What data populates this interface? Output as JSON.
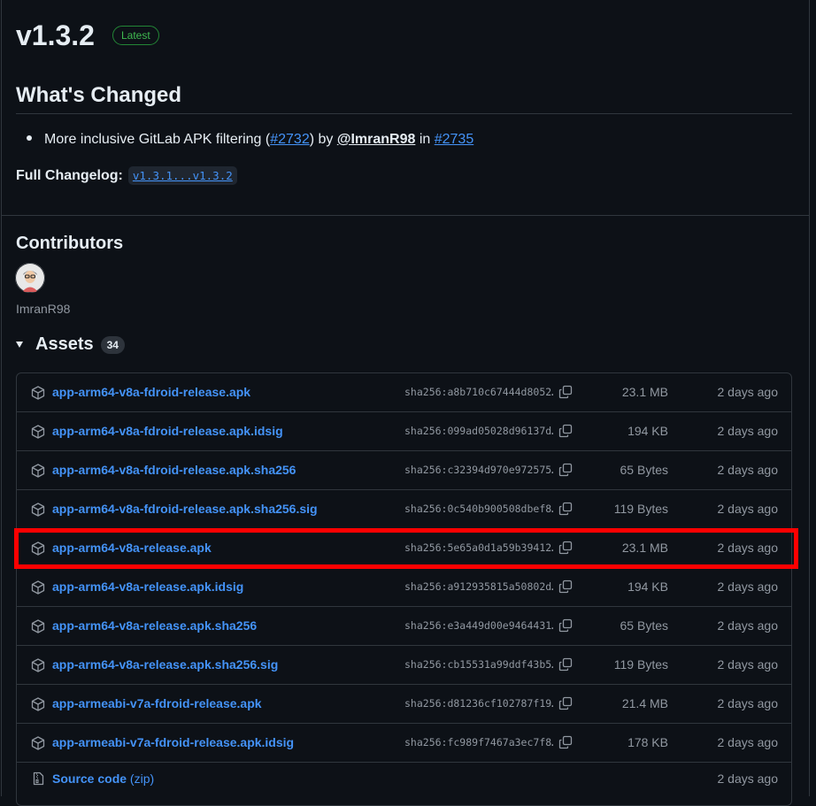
{
  "release": {
    "title": "v1.3.2",
    "latest_badge": "Latest"
  },
  "whats_changed": {
    "heading": "What's Changed",
    "item": {
      "text_start": "More inclusive GitLab APK filtering (",
      "pr_link": "#2732",
      "text_mid": ") by ",
      "author": "@ImranR98",
      "text_in": " in ",
      "in_link": "#2735"
    },
    "full_changelog_label": "Full Changelog:",
    "full_changelog_link": "v1.3.1...v1.3.2"
  },
  "contributors": {
    "heading": "Contributors",
    "names": [
      "ImranR98"
    ]
  },
  "assets": {
    "heading": "Assets",
    "count": "34",
    "rows": [
      {
        "name": "app-arm64-v8a-fdroid-release.apk",
        "sha": "sha256:a8b710c67444d8052…",
        "size": "23.1 MB",
        "date": "2 days ago"
      },
      {
        "name": "app-arm64-v8a-fdroid-release.apk.idsig",
        "sha": "sha256:099ad05028d96137d…",
        "size": "194 KB",
        "date": "2 days ago"
      },
      {
        "name": "app-arm64-v8a-fdroid-release.apk.sha256",
        "sha": "sha256:c32394d970e972575…",
        "size": "65 Bytes",
        "date": "2 days ago"
      },
      {
        "name": "app-arm64-v8a-fdroid-release.apk.sha256.sig",
        "sha": "sha256:0c540b900508dbef8…",
        "size": "119 Bytes",
        "date": "2 days ago"
      },
      {
        "name": "app-arm64-v8a-release.apk",
        "sha": "sha256:5e65a0d1a59b39412…",
        "size": "23.1 MB",
        "date": "2 days ago"
      },
      {
        "name": "app-arm64-v8a-release.apk.idsig",
        "sha": "sha256:a912935815a50802d…",
        "size": "194 KB",
        "date": "2 days ago"
      },
      {
        "name": "app-arm64-v8a-release.apk.sha256",
        "sha": "sha256:e3a449d00e9464431…",
        "size": "65 Bytes",
        "date": "2 days ago"
      },
      {
        "name": "app-arm64-v8a-release.apk.sha256.sig",
        "sha": "sha256:cb15531a99ddf43b5…",
        "size": "119 Bytes",
        "date": "2 days ago"
      },
      {
        "name": "app-armeabi-v7a-fdroid-release.apk",
        "sha": "sha256:d81236cf102787f19…",
        "size": "21.4 MB",
        "date": "2 days ago"
      },
      {
        "name": "app-armeabi-v7a-fdroid-release.apk.idsig",
        "sha": "sha256:fc989f7467a3ec7f8…",
        "size": "178 KB",
        "date": "2 days ago"
      }
    ],
    "source_code": {
      "label": "Source code",
      "suffix": "(zip)",
      "date": "2 days ago"
    }
  },
  "colors": {
    "background": "#0d1117",
    "link": "#4493f8",
    "muted": "#9198a1",
    "border": "#30363d",
    "latest_green": "#3fb950",
    "highlight_box": "#ff0000"
  },
  "icons": {
    "asset_row": "package-icon",
    "copy": "copy-icon",
    "source": "file-zip-icon",
    "toggle": "triangle-down-icon"
  }
}
